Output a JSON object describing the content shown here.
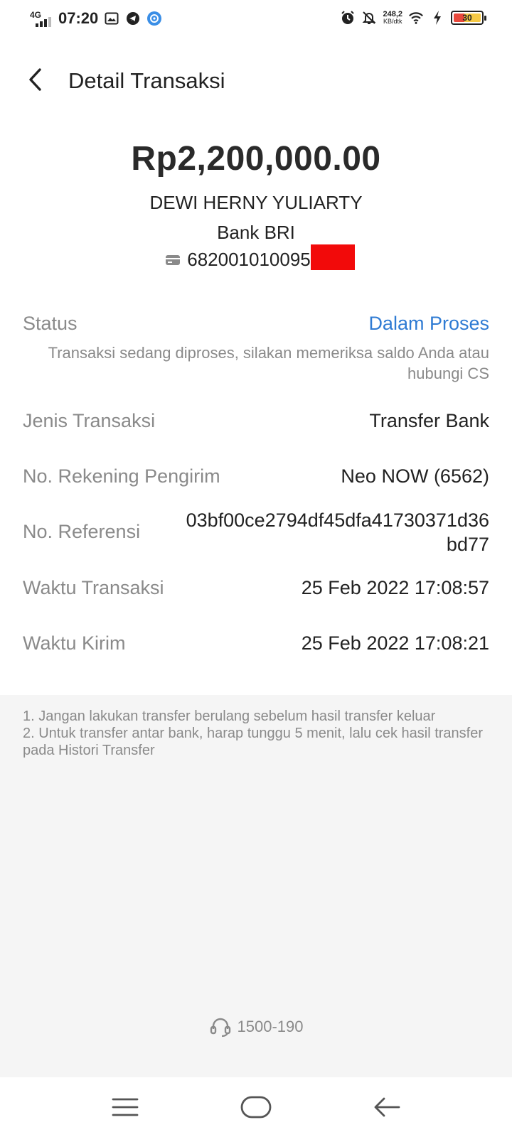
{
  "status_bar": {
    "network": "4G",
    "time": "07:20",
    "speed_value": "248,2",
    "speed_unit": "KB/dtk",
    "battery": "30"
  },
  "header": {
    "title": "Detail Transaksi"
  },
  "summary": {
    "amount": "Rp2,200,000.00",
    "recipient_name": "DEWI HERNY YULIARTY",
    "bank_name": "Bank BRI",
    "account_number": "682001010095"
  },
  "details": {
    "status_label": "Status",
    "status_value": "Dalam Proses",
    "status_description": "Transaksi sedang diproses, silakan memeriksa saldo Anda atau hubungi CS",
    "type_label": "Jenis Transaksi",
    "type_value": "Transfer Bank",
    "sender_label": "No. Rekening Pengirim",
    "sender_value": "Neo NOW (6562)",
    "reference_label": "No. Referensi",
    "reference_value": "03bf00ce2794df45dfa41730371d36bd77",
    "transaction_time_label": "Waktu Transaksi",
    "transaction_time_value": "25 Feb 2022 17:08:57",
    "send_time_label": "Waktu Kirim",
    "send_time_value": "25 Feb 2022 17:08:21"
  },
  "notes": {
    "line1": "1. Jangan lakukan transfer berulang sebelum hasil transfer keluar",
    "line2": "2. Untuk transfer antar bank, harap tunggu 5 menit, lalu cek hasil transfer pada Histori Transfer"
  },
  "support": {
    "hotline": "1500-190"
  },
  "colors": {
    "status_blue": "#2f7bd3",
    "label_gray": "#8a8a8a",
    "footer_bg": "#f5f5f5",
    "redaction_red": "#f20a0a"
  },
  "icons": {
    "back": "chevron-left-icon",
    "account": "card-icon",
    "hotline": "headset-icon",
    "nav_menu": "menu-icon",
    "nav_home": "home-icon",
    "nav_back": "arrow-left-icon"
  }
}
